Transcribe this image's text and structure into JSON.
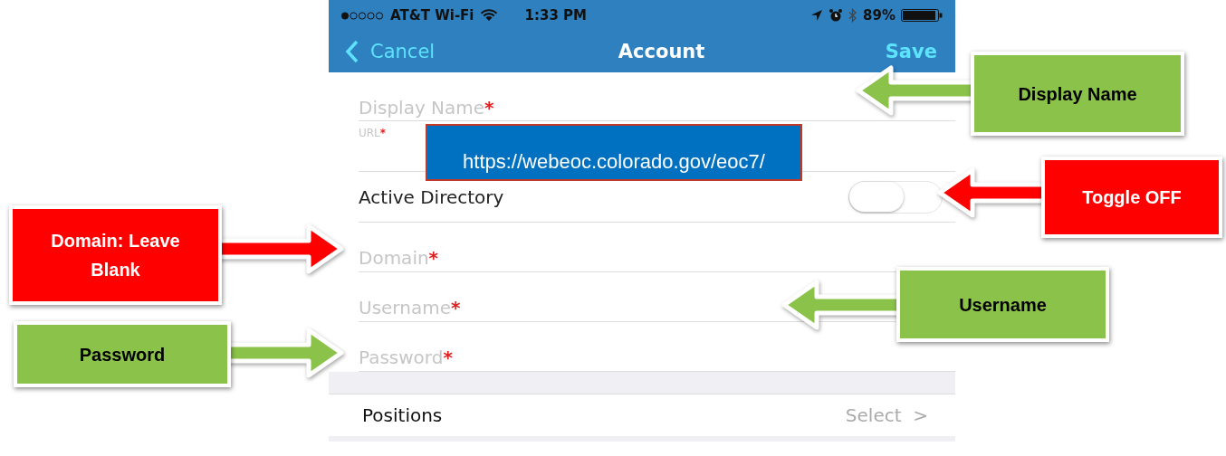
{
  "status_bar": {
    "carrier": "AT&T Wi-Fi",
    "time": "1:33 PM",
    "battery": "89%"
  },
  "nav": {
    "back": "Cancel",
    "title": "Account",
    "action": "Save"
  },
  "fields": [
    {
      "placeholder": "Display Name",
      "required_mark": "*"
    }
  ],
  "url": {
    "label": "URL",
    "required_mark": "*",
    "overlay": "https://webeoc.colorado.gov/eoc7/"
  },
  "active_directory": {
    "label": "Active Directory",
    "on": false
  },
  "login_fields": [
    {
      "placeholder": "Domain",
      "required_mark": "*"
    },
    {
      "placeholder": "Username",
      "required_mark": "*"
    },
    {
      "placeholder": "Password",
      "required_mark": "*"
    }
  ],
  "positions": {
    "label": "Positions",
    "value": "Select",
    "chevron": ">"
  },
  "callouts": [
    {
      "text": "Display Name",
      "color": "#8bc34a",
      "kind": "left"
    },
    {
      "text": "Toggle OFF",
      "color": "#ff0000",
      "kind": "left"
    },
    {
      "text": "Domain: Leave Blank",
      "color": "#ff0000",
      "kind": "right"
    },
    {
      "text": "Username",
      "color": "#8bc34a",
      "kind": "left"
    },
    {
      "text": "Password",
      "color": "#8bc34a",
      "kind": "right"
    }
  ]
}
